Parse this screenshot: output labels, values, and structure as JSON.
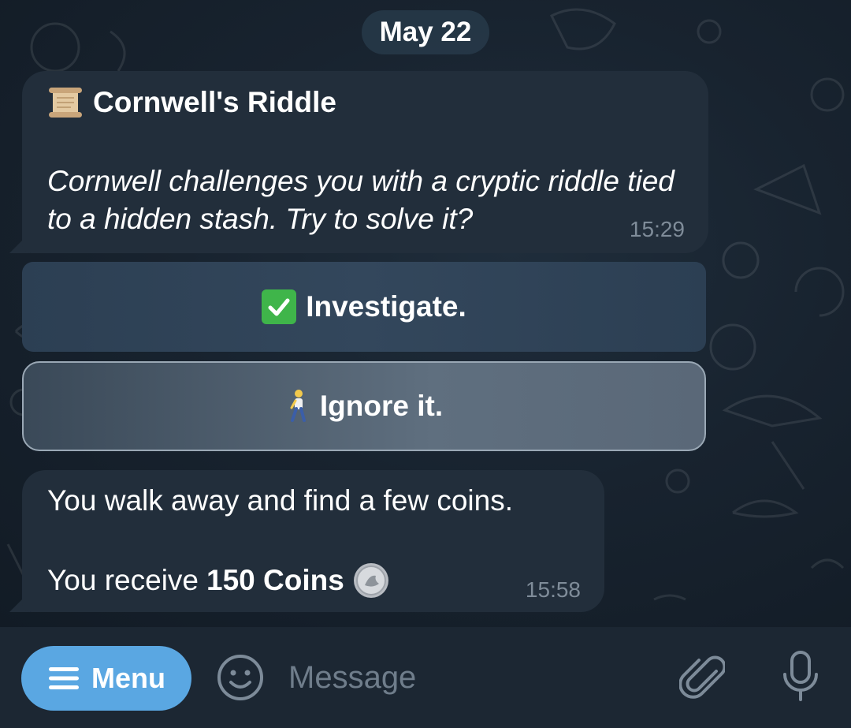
{
  "date_separator": "May 22",
  "messages": [
    {
      "title": "Cornwell's Riddle",
      "title_icon": "scroll-icon",
      "body": "Cornwell challenges you with a cryptic riddle tied to a hidden stash. Try to solve it?",
      "time": "15:29"
    },
    {
      "line1": "You walk away and find a few coins.",
      "line2_prefix": "You receive",
      "line2_bold": "150 Coins",
      "line2_icon": "coin-icon",
      "time": "15:58"
    }
  ],
  "inline_buttons": [
    {
      "label": "Investigate.",
      "icon": "check-mark-icon",
      "selected": false
    },
    {
      "label": "Ignore it.",
      "icon": "walking-person-icon",
      "selected": true
    }
  ],
  "input_bar": {
    "menu_label": "Menu",
    "placeholder": "Message",
    "value": ""
  },
  "colors": {
    "background": "#18232f",
    "bubble": "#222e3b",
    "accent": "#5aa7e2",
    "timestamp": "#7f8c99",
    "check_green": "#3fb54a"
  }
}
